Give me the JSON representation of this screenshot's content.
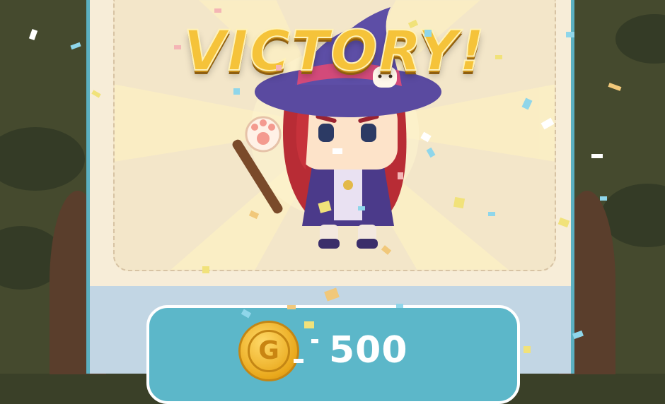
{
  "title": "VICTORY!",
  "reward": {
    "currency_icon": "gold-coin-icon",
    "coin_letter": "G",
    "amount": "500"
  },
  "colors": {
    "panel_border": "#5bb0c1",
    "reward_box": "#5cb7c9",
    "title_gold": "#f5c33a"
  }
}
